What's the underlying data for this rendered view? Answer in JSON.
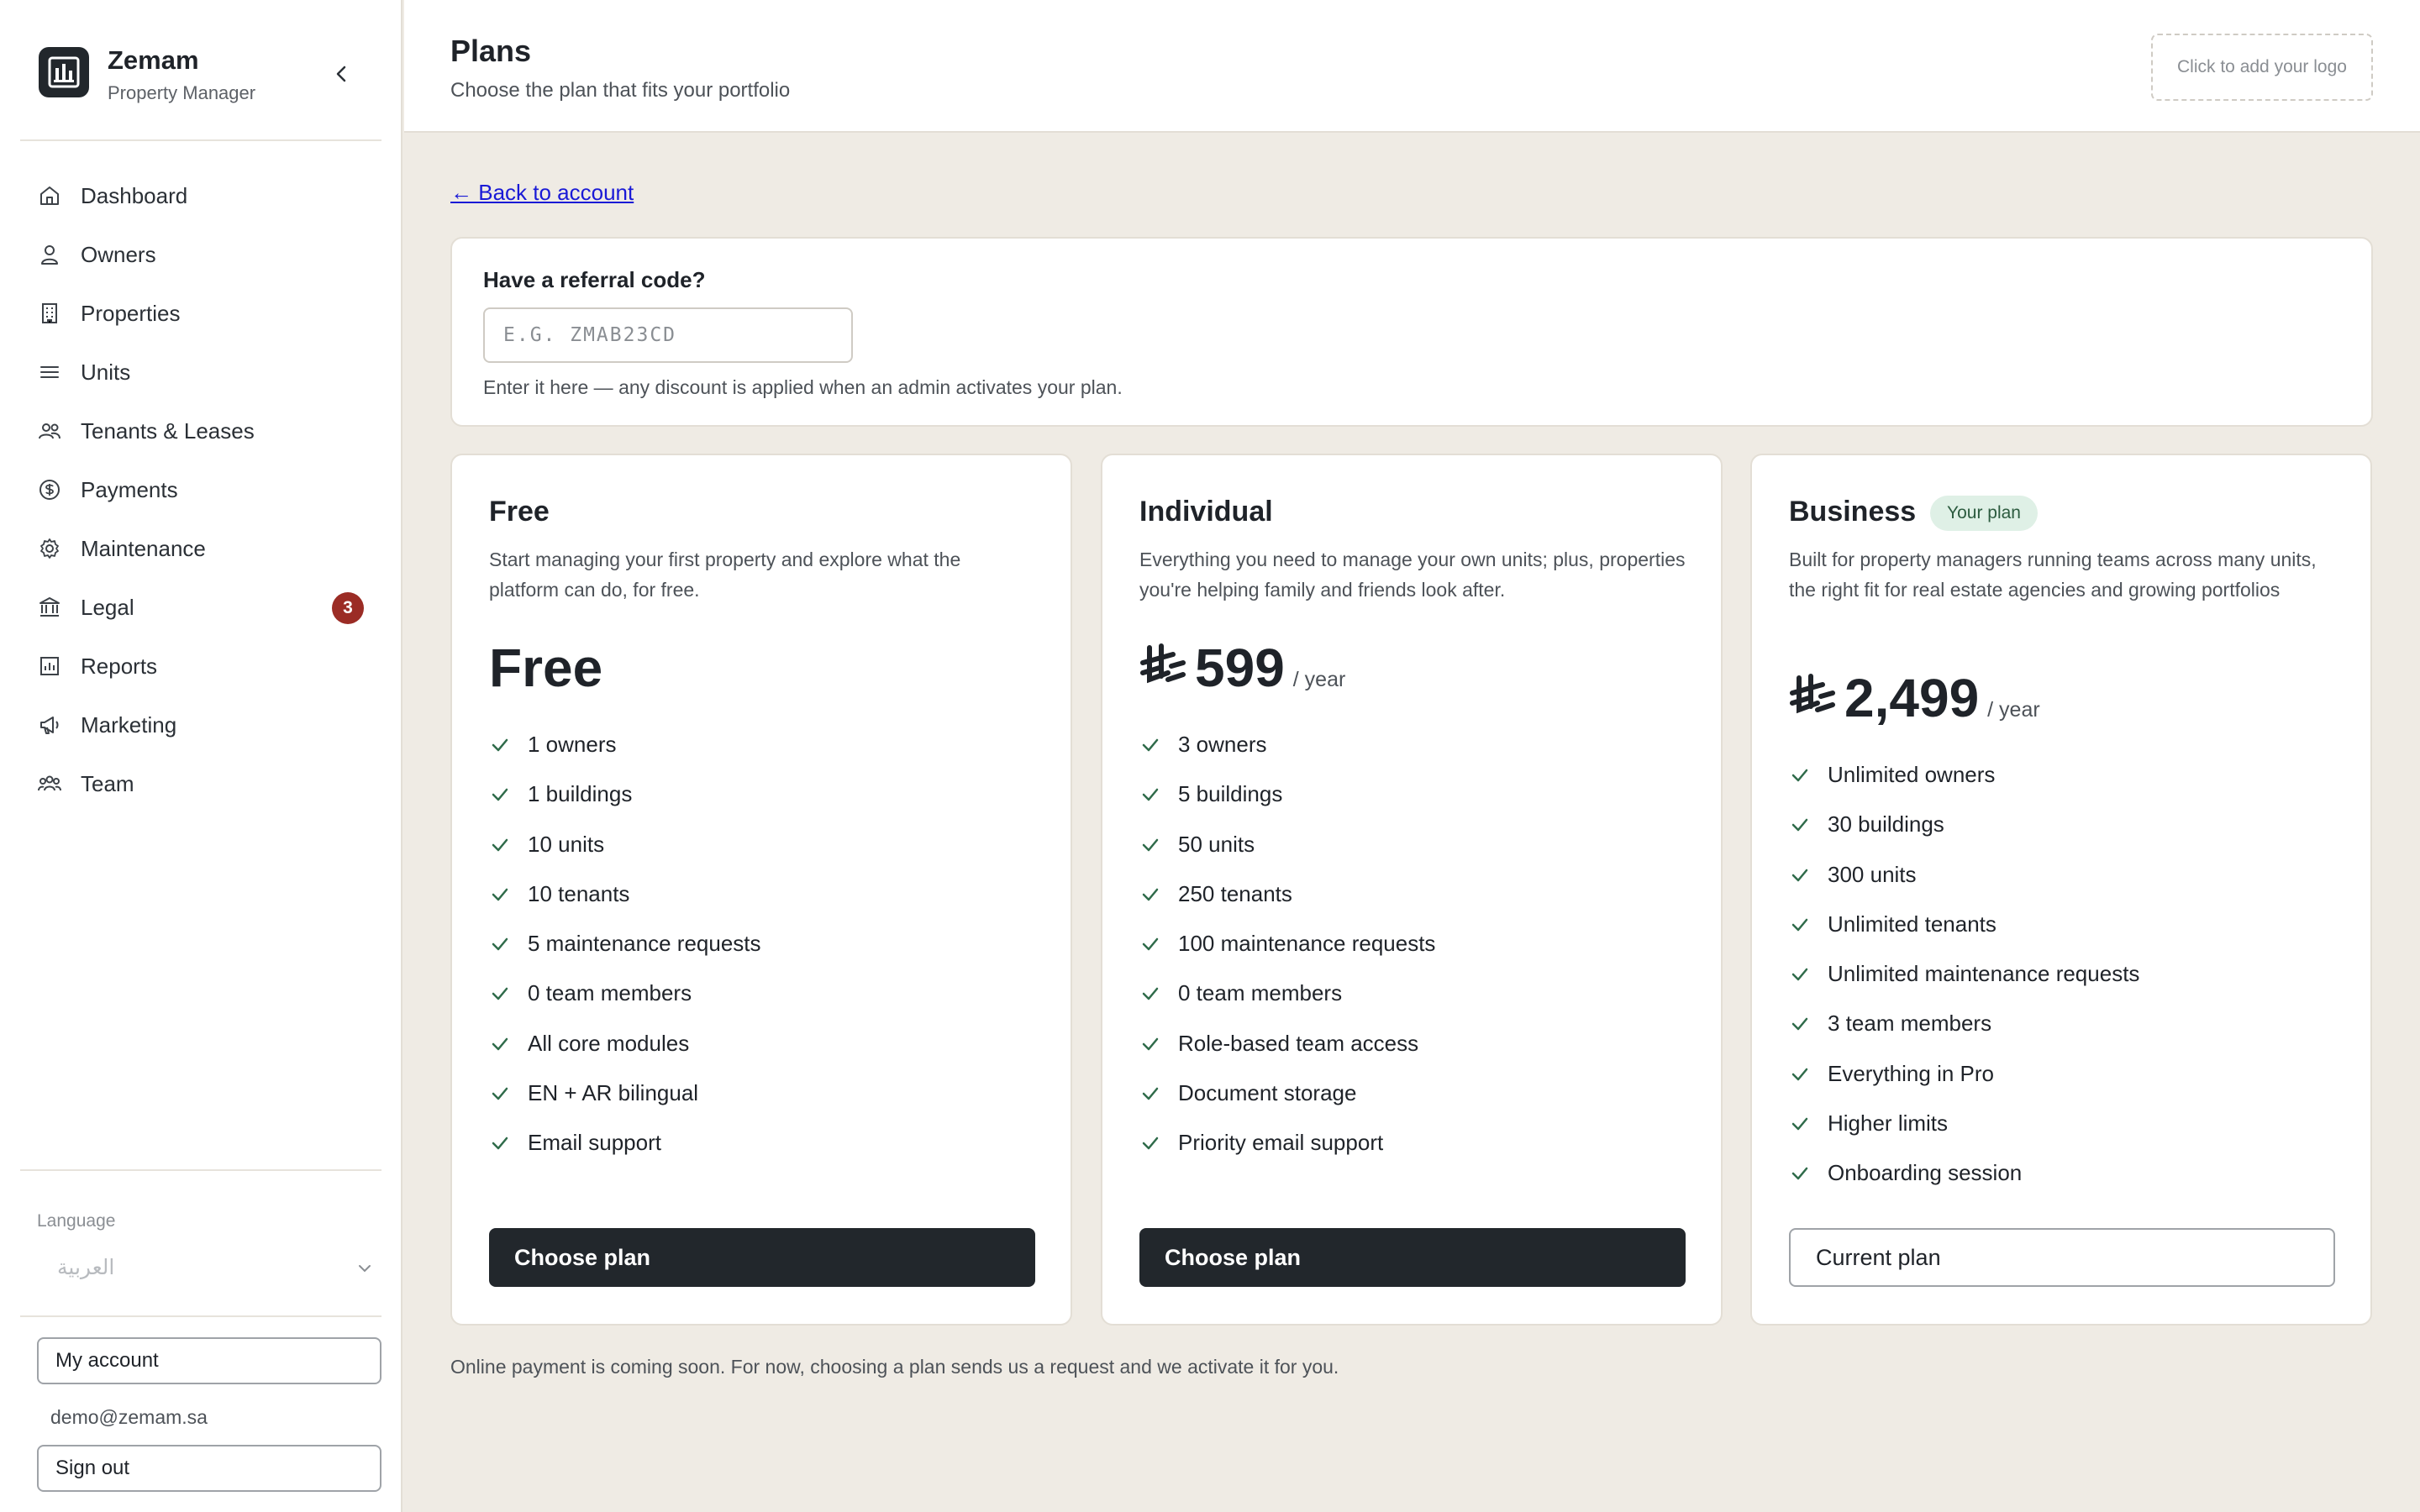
{
  "brand": {
    "name": "Zemam",
    "subtitle": "Property Manager"
  },
  "sidebar": {
    "items": [
      {
        "label": "Dashboard",
        "icon": "home-icon"
      },
      {
        "label": "Owners",
        "icon": "user-icon"
      },
      {
        "label": "Properties",
        "icon": "building-icon"
      },
      {
        "label": "Units",
        "icon": "list-icon"
      },
      {
        "label": "Tenants & Leases",
        "icon": "users-icon"
      },
      {
        "label": "Payments",
        "icon": "dollar-icon"
      },
      {
        "label": "Maintenance",
        "icon": "gear-icon"
      },
      {
        "label": "Legal",
        "icon": "bank-icon",
        "badge": "3"
      },
      {
        "label": "Reports",
        "icon": "chart-icon"
      },
      {
        "label": "Marketing",
        "icon": "megaphone-icon"
      },
      {
        "label": "Team",
        "icon": "team-icon"
      }
    ],
    "language": {
      "label": "Language",
      "value": "العربية"
    },
    "my_account": "My account",
    "email": "demo@zemam.sa",
    "sign_out": "Sign out"
  },
  "header": {
    "title": "Plans",
    "subtitle": "Choose the plan that fits your portfolio",
    "logo_placeholder": "Click to add your logo"
  },
  "main": {
    "back_link": "← Back to account",
    "referral": {
      "title": "Have a referral code?",
      "placeholder": "E.G. ZMAB23CD",
      "hint": "Enter it here — any discount is applied when an admin activates your plan."
    },
    "plans": [
      {
        "name": "Free",
        "description": "Start managing your first property and explore what the platform can do, for free.",
        "price": "Free",
        "features": [
          "1 owners",
          "1 buildings",
          "10 units",
          "10 tenants",
          "5 maintenance requests",
          "0 team members",
          "All core modules",
          "EN + AR bilingual",
          "Email support"
        ],
        "button": "Choose plan"
      },
      {
        "name": "Individual",
        "description": "Everything you need to manage your own units; plus, properties you're helping family and friends look after.",
        "price": "599",
        "period": "/ year",
        "features": [
          "3 owners",
          "5 buildings",
          "50 units",
          "250 tenants",
          "100 maintenance requests",
          "0 team members",
          "Role-based team access",
          "Document storage",
          "Priority email support"
        ],
        "button": "Choose plan"
      },
      {
        "name": "Business",
        "badge": "Your plan",
        "description": "Built for property managers running teams across many units, the right fit for real estate agencies and growing portfolios",
        "price": "2,499",
        "period": "/ year",
        "features": [
          "Unlimited owners",
          "30 buildings",
          "300 units",
          "Unlimited tenants",
          "Unlimited maintenance requests",
          "3 team members",
          "Everything in Pro",
          "Higher limits",
          "Onboarding session"
        ],
        "button": "Current plan"
      }
    ],
    "footnote": "Online payment is coming soon. For now, choosing a plan sends us a request and we activate it for you."
  },
  "colors": {
    "accent_dark": "#22272c",
    "background": "#efebe4",
    "badge_red": "#9b2c25",
    "badge_green_bg": "#dff0e6",
    "check_green": "#2f6b4a",
    "link": "#1a1ad6"
  }
}
